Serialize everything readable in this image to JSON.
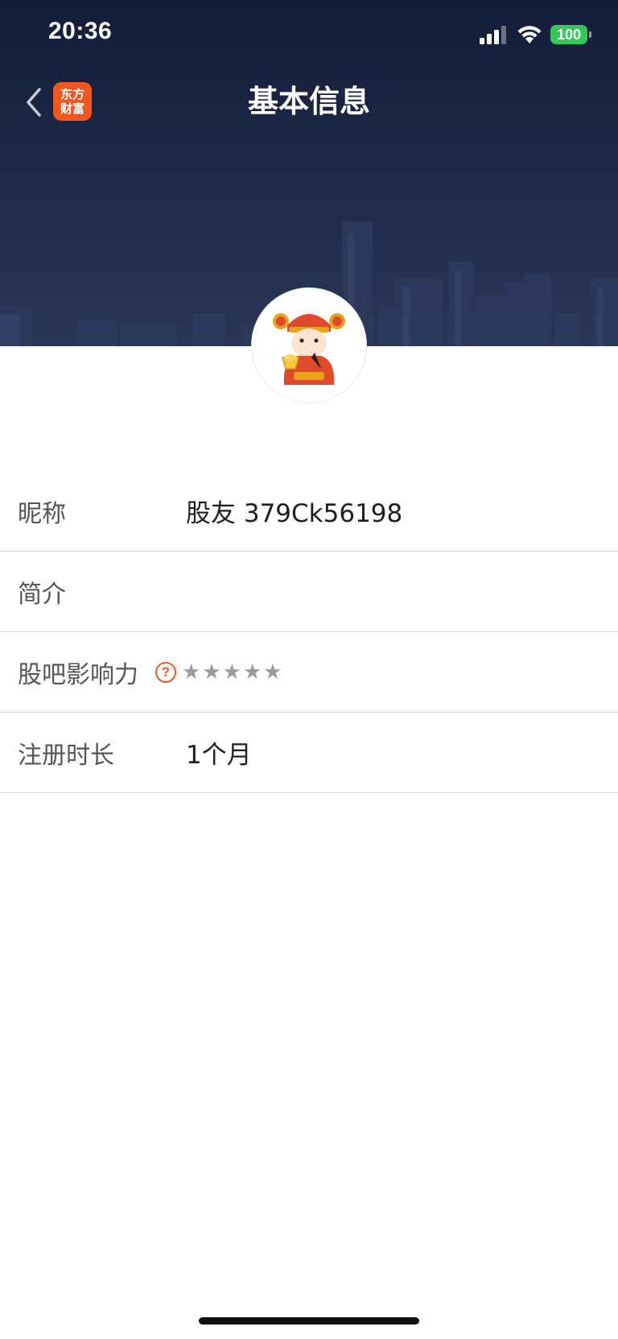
{
  "status_bar": {
    "time": "20:36",
    "battery": "100",
    "colors": {
      "battery": "#34c759"
    }
  },
  "nav": {
    "title": "基本信息",
    "logo_line1": "东方",
    "logo_line2": "财富",
    "back_icon": "chevron-left-icon"
  },
  "avatar": {
    "icon": "fortune-god-avatar"
  },
  "rows": [
    {
      "label": "昵称",
      "value": "股友 379Ck56198"
    },
    {
      "label": "简介",
      "value": ""
    },
    {
      "label": "股吧影响力",
      "help": "?",
      "stars": [
        "★",
        "★",
        "★",
        "★",
        "★"
      ],
      "star_rating": 0
    },
    {
      "label": "注册时长",
      "value": "1个月"
    }
  ],
  "colors": {
    "banner": "#1d2848",
    "accent": "#ee5a24",
    "logo": "#f0561e"
  }
}
